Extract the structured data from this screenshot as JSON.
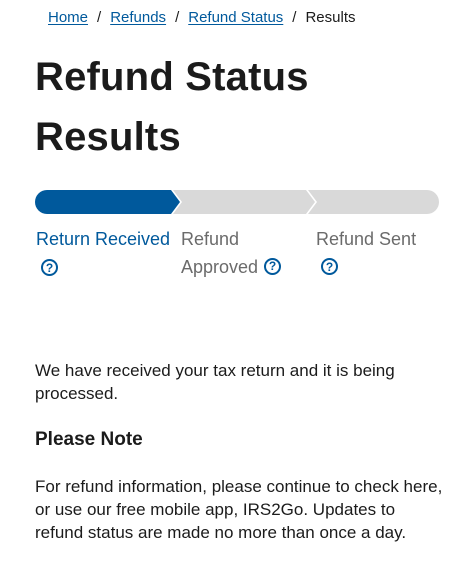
{
  "breadcrumb": {
    "items": [
      {
        "label": "Home"
      },
      {
        "label": "Refunds"
      },
      {
        "label": "Refund Status"
      }
    ],
    "separator": "/",
    "current": "Results"
  },
  "page": {
    "title": "Refund Status Results"
  },
  "tracker": {
    "active_color": "#00599c",
    "inactive_color": "#d9d9d9",
    "current_step": 1,
    "steps": [
      {
        "label": "Return Received",
        "icon": "help-circle-icon",
        "icon_glyph": "?"
      },
      {
        "label": "Refund Approved",
        "icon": "help-circle-icon",
        "icon_glyph": "?"
      },
      {
        "label": "Refund Sent",
        "icon": "help-circle-icon",
        "icon_glyph": "?"
      }
    ]
  },
  "content": {
    "status_message": "We have received your tax return and it is being processed.",
    "note_heading": "Please Note",
    "note_text": "For refund information, please continue to check here, or use our free mobile app, IRS2Go. Updates to refund status are made no more than once a day."
  }
}
